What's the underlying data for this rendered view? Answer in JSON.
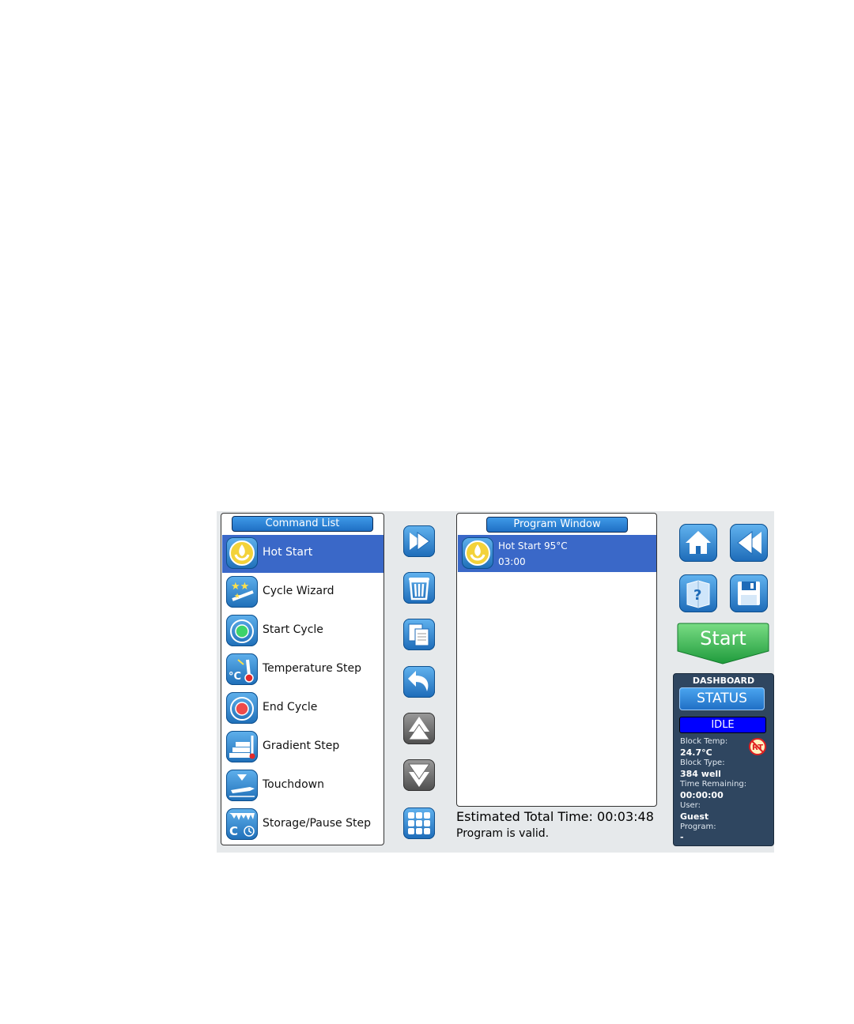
{
  "command_list": {
    "title": "Command List",
    "items": [
      {
        "label": "Hot Start",
        "icon": "flame-icon"
      },
      {
        "label": "Cycle Wizard",
        "icon": "wand-icon"
      },
      {
        "label": "Start Cycle",
        "icon": "green-circle-icon"
      },
      {
        "label": "Temperature Step",
        "icon": "thermometer-icon"
      },
      {
        "label": "End Cycle",
        "icon": "red-circle-icon"
      },
      {
        "label": "Gradient Step",
        "icon": "gradient-icon"
      },
      {
        "label": "Touchdown",
        "icon": "touchdown-icon"
      },
      {
        "label": "Storage/Pause Step",
        "icon": "storage-icon"
      }
    ]
  },
  "toolbar": {
    "buttons": [
      "add-icon",
      "trash-icon",
      "copy-icon",
      "undo-icon",
      "move-up-icon",
      "move-down-icon",
      "keypad-icon"
    ]
  },
  "program_window": {
    "title": "Program Window",
    "items": [
      {
        "line1": "Hot Start 95°C",
        "line2": "03:00"
      }
    ],
    "estimated_label": "Estimated Total Time:",
    "estimated_value": "00:03:48",
    "valid_message": "Program is valid."
  },
  "right_panel": {
    "start_label": "Start"
  },
  "dashboard": {
    "title": "DASHBOARD",
    "status_button": "STATUS",
    "state": "IDLE",
    "block_temp_label": "Block Temp:",
    "block_temp": "24.7°C",
    "block_type_label": "Block Type:",
    "block_type": "384 well",
    "time_remaining_label": "Time Remaining:",
    "time_remaining": "00:00:00",
    "user_label": "User:",
    "user": "Guest",
    "program_label": "Program:",
    "program": "-",
    "rt_badge": "RT"
  },
  "colors": {
    "selection": "#3a68c8",
    "button_blue": "#1f6fc4",
    "start_green": "#2eb24b",
    "dashboard_bg": "#2f4660",
    "idle_blue": "#0000ff"
  }
}
